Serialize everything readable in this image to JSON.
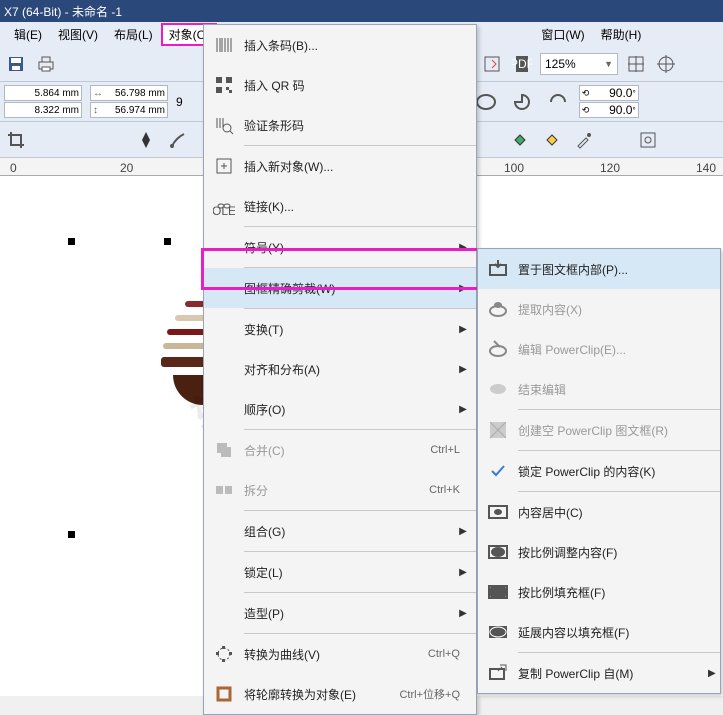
{
  "title": "X7 (64-Bit) - 未命名 -1",
  "menubar": {
    "edit": "辑(E)",
    "view": "视图(V)",
    "layout": "布局(L)",
    "object": "对象(C)",
    "window": "窗口(W)",
    "help": "帮助(H)"
  },
  "property": {
    "x_val": "5.864 mm",
    "y_val": "8.322 mm",
    "w_val": "56.798 mm",
    "h_val": "56.974 mm",
    "extra": "9",
    "angle1": "90.0",
    "angle2": "90.0"
  },
  "toolbar": {
    "zoom_value": "125%"
  },
  "ruler": {
    "t0": "0",
    "t20": "20",
    "t100": "100",
    "t120": "120",
    "t140": "140"
  },
  "menu_object": {
    "insert_barcode": "插入条码(B)...",
    "insert_qr": "插入 QR 码",
    "verify_barcode": "验证条形码",
    "insert_new_object": "插入新对象(W)...",
    "links": "链接(K)...",
    "symbol": "符号(Y)",
    "powerclip": "图框精确剪裁(W)",
    "transform": "变换(T)",
    "align_dist": "对齐和分布(A)",
    "order": "顺序(O)",
    "combine": "合并(C)",
    "combine_sc": "Ctrl+L",
    "break": "拆分",
    "break_sc": "Ctrl+K",
    "group": "组合(G)",
    "lock": "锁定(L)",
    "shaping": "造型(P)",
    "to_curve": "转换为曲线(V)",
    "to_curve_sc": "Ctrl+Q",
    "outline_to_obj": "将轮廓转换为对象(E)",
    "outline_sc": "Ctrl+位移+Q"
  },
  "submenu_powerclip": {
    "place_inside": "置于图文框内部(P)...",
    "extract": "提取内容(X)",
    "edit": "编辑 PowerClip(E)...",
    "finish_edit": "结束编辑",
    "create_empty": "创建空 PowerClip 图文框(R)",
    "lock_content": "锁定 PowerClip 的内容(K)",
    "center_content": "内容居中(C)",
    "fit_prop": "按比例调整内容(F)",
    "fill_prop": "按比例填充框(F)",
    "stretch_fill": "延展内容以填充框(F)",
    "copy_from": "复制 PowerClip 自(M)"
  },
  "watermark_text": "软件自学网 www.rjzxw.com"
}
